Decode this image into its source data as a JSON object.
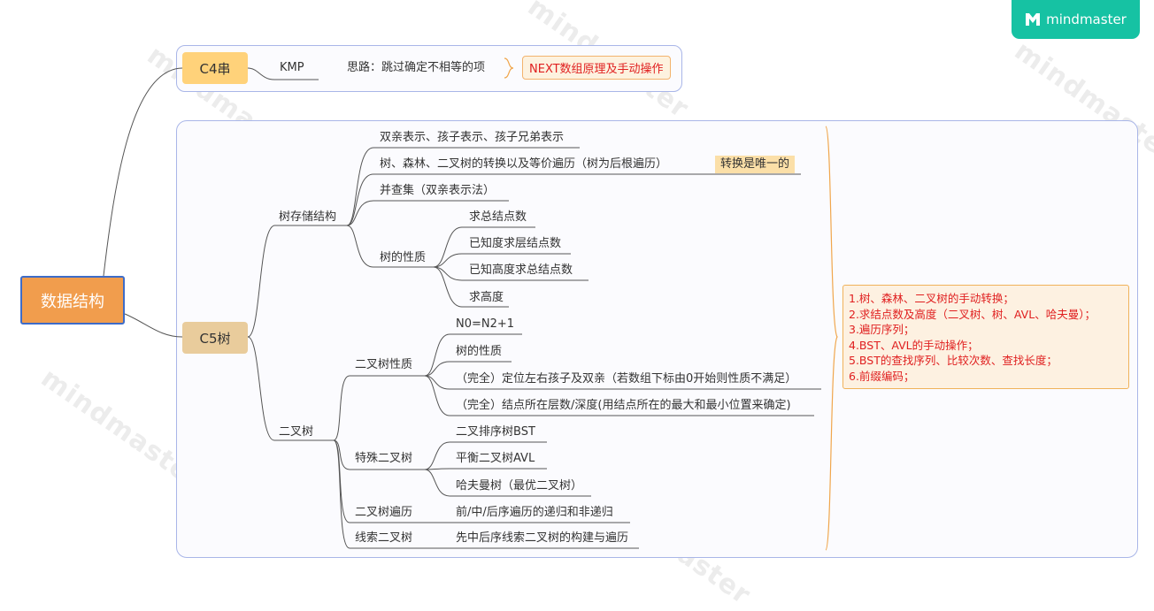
{
  "logo": {
    "text": "mindmaster"
  },
  "watermark": "mindmaster",
  "root": "数据结构",
  "c4": {
    "label": "C4串",
    "kmp": "KMP",
    "idea": "思路：跳过确定不相等的项",
    "note": "NEXT数组原理及手动操作"
  },
  "c5": {
    "label": "C5树",
    "tree_storage": {
      "label": "树存储结构",
      "items": [
        "双亲表示、孩子表示、孩子兄弟表示",
        "树、森林、二叉树的转换以及等价遍历（树为后根遍历）",
        "并查集（双亲表示法）"
      ],
      "highlight": "转换是唯一的",
      "properties": {
        "label": "树的性质",
        "items": [
          "求总结点数",
          "已知度求层结点数",
          "已知高度求总结点数",
          "求高度"
        ]
      }
    },
    "binary_tree": {
      "label": "二叉树",
      "properties": {
        "label": "二叉树性质",
        "items": [
          "N0=N2+1",
          "树的性质",
          "（完全）定位左右孩子及双亲（若数组下标由0开始则性质不满足）",
          "（完全）结点所在层数/深度(用结点所在的最大和最小位置来确定)"
        ]
      },
      "special": {
        "label": "特殊二叉树",
        "items": [
          "二叉排序树BST",
          "平衡二叉树AVL",
          "哈夫曼树（最优二叉树）"
        ]
      },
      "traversal": {
        "label": "二叉树遍历",
        "item": "前/中/后序遍历的递归和非递归"
      },
      "threaded": {
        "label": "线索二叉树",
        "item": "先中后序线索二叉树的构建与遍历"
      }
    },
    "summary": [
      "1.树、森林、二叉树的手动转换；",
      "2.求结点数及高度（二叉树、树、AVL、哈夫曼）；",
      "3.遍历序列；",
      "4.BST、AVL的手动操作；",
      "5.BST的查找序列、比较次数、查找长度；",
      "6.前缀编码；"
    ]
  },
  "colors": {
    "root_fill": "#f19d4d",
    "root_border": "#3e6cc8",
    "c4_fill": "#ffd27a",
    "c5_fill": "#e9cc9c",
    "note_text": "#e02020",
    "logo_fill": "#16c2a3"
  }
}
